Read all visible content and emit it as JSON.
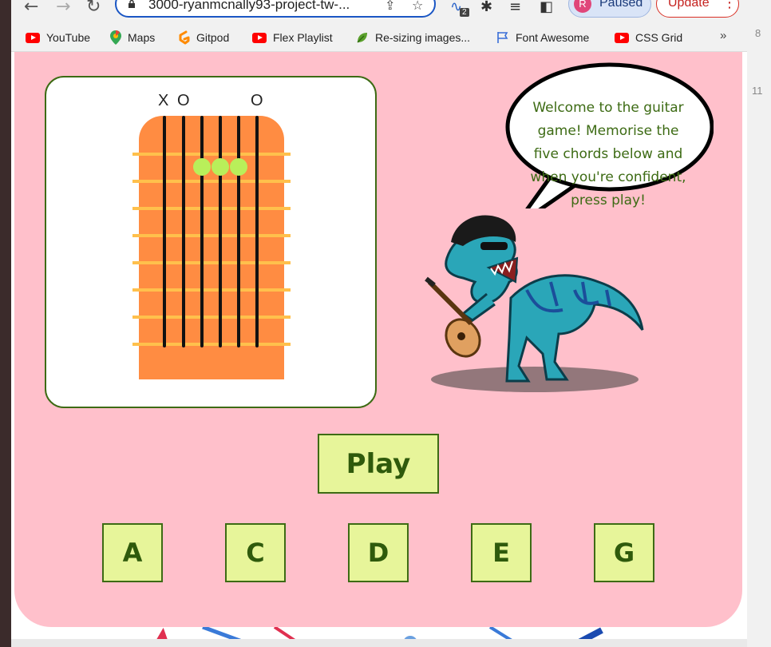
{
  "browser": {
    "url": "3000-ryanmcnally93-project-tw-...",
    "profile_initial": "R",
    "profile_status": "Paused",
    "update_label": "Update",
    "extension_badge": "2",
    "bookmarks": [
      {
        "label": "YouTube",
        "icon": "youtube-icon"
      },
      {
        "label": "Maps",
        "icon": "maps-pin-icon"
      },
      {
        "label": "Gitpod",
        "icon": "gitpod-icon"
      },
      {
        "label": "Flex Playlist",
        "icon": "youtube-icon"
      },
      {
        "label": "Re-sizing images...",
        "icon": "leaf-icon"
      },
      {
        "label": "Font Awesome",
        "icon": "flag-icon"
      },
      {
        "label": "CSS Grid",
        "icon": "youtube-icon"
      }
    ],
    "more_label": "»",
    "side_numbers": [
      "8",
      "11"
    ]
  },
  "game": {
    "chord_markers": [
      "X",
      "O",
      "O"
    ],
    "speech": "Welcome to the guitar game! Memorise the five chords below and when you're confident, press play!",
    "play_label": "Play",
    "chord_buttons": [
      "A",
      "C",
      "D",
      "E",
      "G"
    ]
  },
  "colors": {
    "board_bg": "#ffc0cb",
    "button_bg": "#e7f59a",
    "button_border": "#3d6b14",
    "fretboard": "#ff8c42",
    "finger_dot": "#b9ef5a"
  }
}
